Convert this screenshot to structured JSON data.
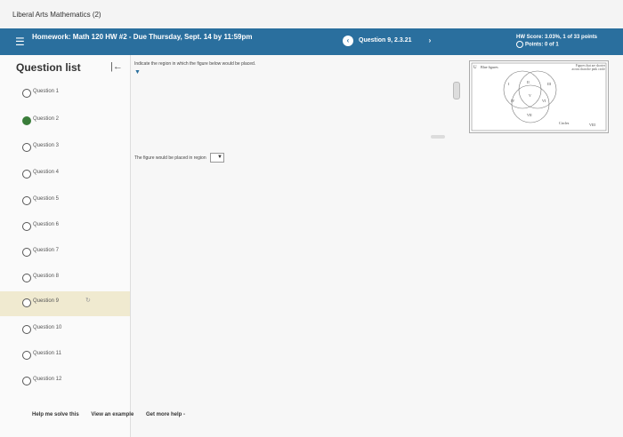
{
  "app_title": "Liberal Arts Mathematics (2)",
  "header": {
    "assignment_title": "Homework: Math 120 HW #2 - Due Thursday, Sept. 14 by 11:59pm",
    "question_label": "Question 9, 2.3.21",
    "hw_score": "HW Score: 3.03%, 1 of 33 points",
    "points": "Points: 0 of 1"
  },
  "sidebar": {
    "title": "Question list",
    "items": [
      {
        "label": "Question 1",
        "status": "open"
      },
      {
        "label": "Question 2",
        "status": "done"
      },
      {
        "label": "Question 3",
        "status": "open"
      },
      {
        "label": "Question 4",
        "status": "open"
      },
      {
        "label": "Question 5",
        "status": "open"
      },
      {
        "label": "Question 6",
        "status": "open"
      },
      {
        "label": "Question 7",
        "status": "open"
      },
      {
        "label": "Question 8",
        "status": "open"
      },
      {
        "label": "Question 9",
        "status": "current"
      },
      {
        "label": "Question 10",
        "status": "open"
      },
      {
        "label": "Question 11",
        "status": "open"
      },
      {
        "label": "Question 12",
        "status": "open"
      }
    ]
  },
  "main": {
    "instruction": "Indicate the region in which the figure below would be placed.",
    "answer_prompt": "The figure would be placed in region"
  },
  "figure": {
    "u_label": "U",
    "set_label": "Blue figures",
    "circles_label": "Circles",
    "side_text": "Figures that are shorter across than the pink circle",
    "regions": [
      "I",
      "II",
      "III",
      "IV",
      "V",
      "VI",
      "VII",
      "VIII"
    ]
  },
  "footer": {
    "help_solve": "Help me solve this",
    "view_example": "View an example",
    "get_more_help": "Get more help -"
  },
  "colors": {
    "header_blue": "#2a6f9e",
    "done_green": "#3a7d3a",
    "active_row": "#f0ead0"
  }
}
